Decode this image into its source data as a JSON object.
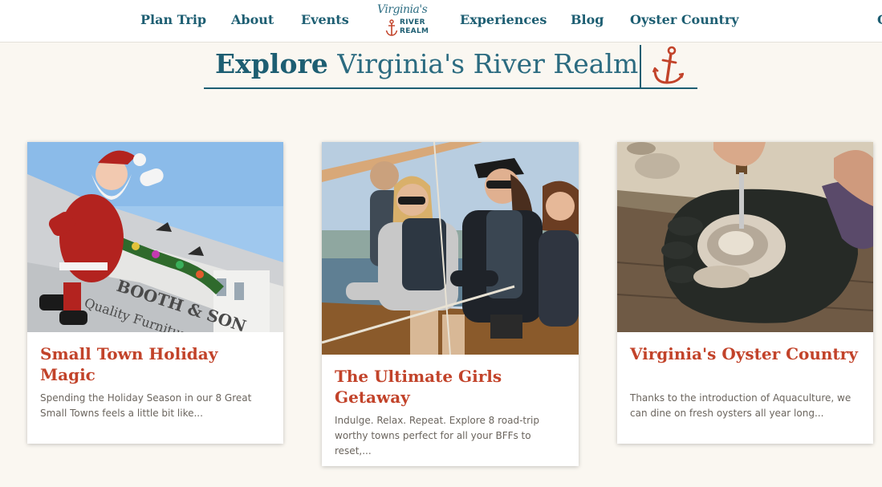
{
  "nav": {
    "items": [
      "Plan Trip",
      "About",
      "Events",
      "Experiences",
      "Blog",
      "Oyster Country"
    ],
    "cut_item": "C"
  },
  "logo": {
    "script": "Virginia's",
    "line1": "RIVER",
    "line2": "REALM"
  },
  "heading": {
    "strong": "Explore",
    "light": "Virginia's River Realm"
  },
  "cards": [
    {
      "title": "Small Town Holiday Magic",
      "excerpt": "Spending the Holiday Season in our 8 Great Small Towns feels a little bit like..."
    },
    {
      "title": "The Ultimate Girls Getaway",
      "excerpt": "Indulge. Relax. Repeat. Explore 8 road-trip worthy towns perfect for all your BFFs to reset,..."
    },
    {
      "title": "Virginia's Oyster Country",
      "excerpt": "Thanks to the introduction of Aquaculture, we can dine on fresh oysters all year long..."
    }
  ],
  "colors": {
    "brand_teal": "#1d5e72",
    "accent_red": "#c2432a",
    "page_background": "#faf7f1"
  },
  "icons": [
    "anchor-icon"
  ]
}
